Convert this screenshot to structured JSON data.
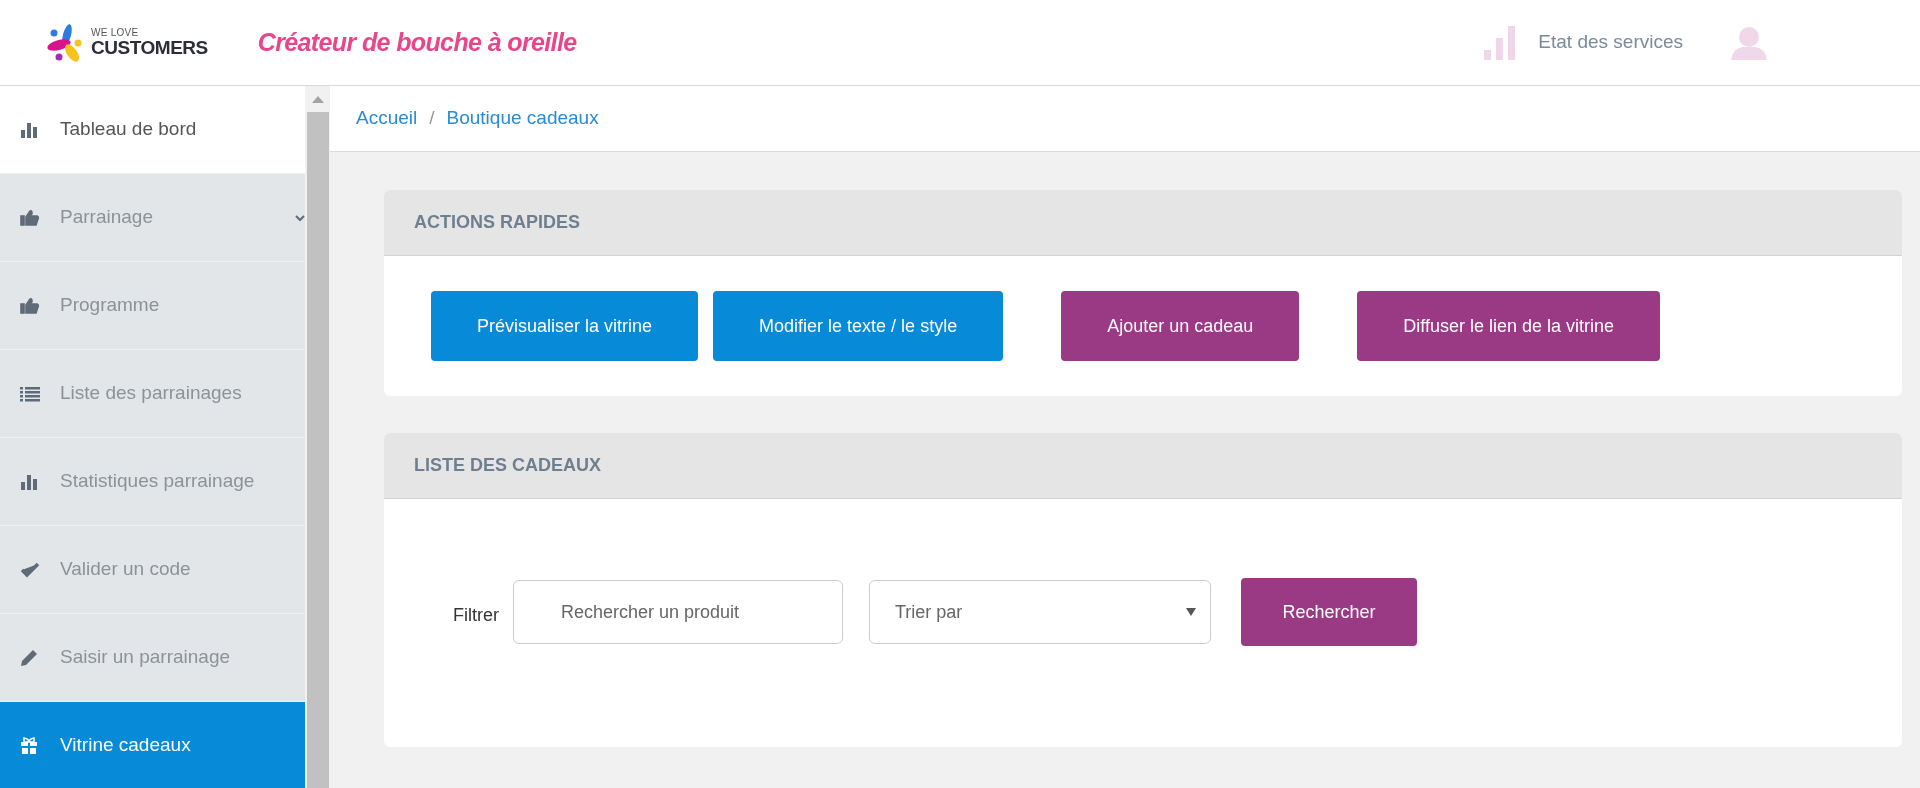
{
  "header": {
    "logo": {
      "small": "WE LOVE",
      "big": "CUSTOMERS"
    },
    "tagline": "Créateur de bouche à oreille",
    "status_link": "Etat des services"
  },
  "sidebar": {
    "items": [
      {
        "label": "Tableau de bord",
        "kind": "bars",
        "selected": false,
        "highlight": true
      },
      {
        "label": "Parrainage",
        "kind": "thumb",
        "selected": false,
        "expanded": false
      },
      {
        "label": "Programme",
        "kind": "thumb",
        "selected": false
      },
      {
        "label": "Liste des parrainages",
        "kind": "list",
        "selected": false
      },
      {
        "label": "Statistiques parrainage",
        "kind": "bars",
        "selected": false
      },
      {
        "label": "Valider un code",
        "kind": "check",
        "selected": false
      },
      {
        "label": "Saisir un parrainage",
        "kind": "pencil",
        "selected": false
      },
      {
        "label": "Vitrine cadeaux",
        "kind": "gift",
        "selected": true
      }
    ]
  },
  "breadcrumb": {
    "separator": "/",
    "links": [
      "Accueil",
      "Boutique cadeaux"
    ]
  },
  "quick_actions": {
    "title": "ACTIONS RAPIDES",
    "buttons": [
      {
        "label": "Prévisualiser la vitrine",
        "kind": "primary"
      },
      {
        "label": "Modifier le texte / le style",
        "kind": "primary"
      },
      {
        "label": "Ajouter un cadeau",
        "kind": "accent"
      },
      {
        "label": "Diffuser le lien de la vitrine",
        "kind": "accent"
      }
    ]
  },
  "gift_list": {
    "title": "LISTE DES CADEAUX",
    "filter_label": "Filtrer",
    "search": {
      "placeholder": "Rechercher un produit"
    },
    "sort": {
      "placeholder": "Trier par"
    },
    "search_button": "Rechercher"
  }
}
